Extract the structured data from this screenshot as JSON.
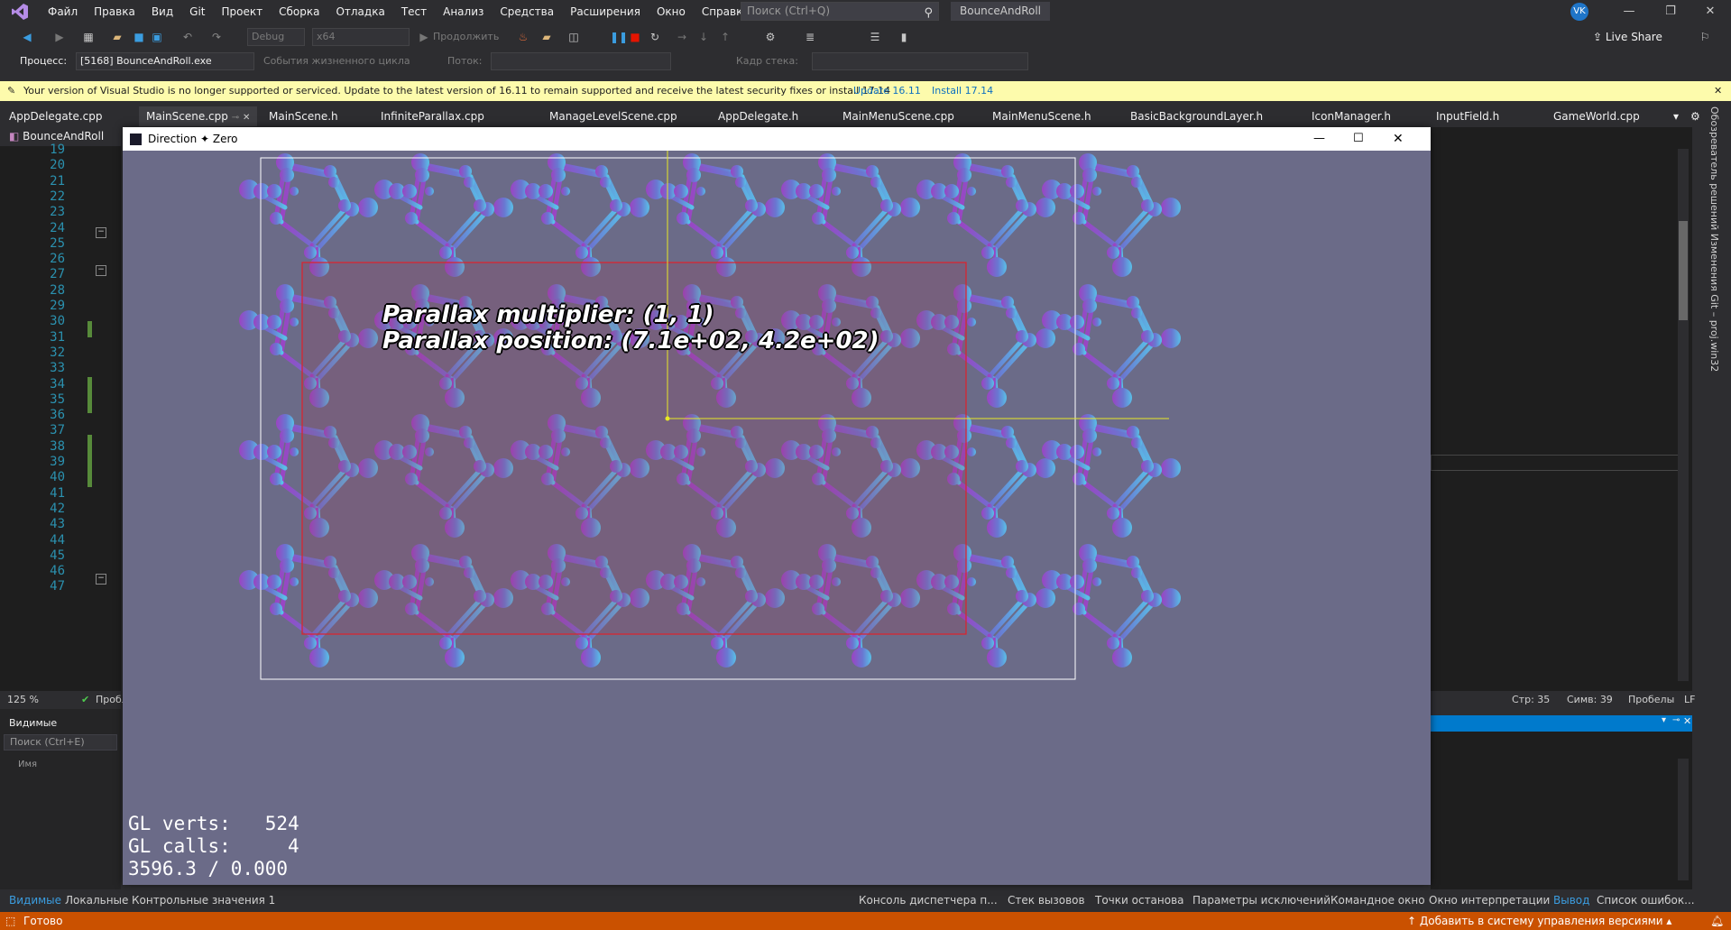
{
  "menu": {
    "items": [
      "Файл",
      "Правка",
      "Вид",
      "Git",
      "Проект",
      "Сборка",
      "Отладка",
      "Тест",
      "Анализ",
      "Средства",
      "Расширения",
      "Окно",
      "Справка"
    ],
    "search_placeholder": "Поиск (Ctrl+Q)",
    "solution_name": "BounceAndRoll",
    "user_initials": "VK"
  },
  "toolbar": {
    "config": "Debug",
    "platform": "x64",
    "continue_label": "Продолжить",
    "live_share": "Live Share",
    "process_label": "Процесс:",
    "process_value": "[5168] BounceAndRoll.exe",
    "lifecycle_label": "События жизненного цикла",
    "thread_label": "Поток:",
    "stack_frame_label": "Кадр стека:"
  },
  "infobar": {
    "message": "Your version of Visual Studio is no longer supported or serviced. Update to the latest version of 16.11 to remain supported and receive the latest security fixes or install 17.14",
    "link_update": "Update 16.11",
    "link_install": "Install 17.14"
  },
  "tabs": [
    "AppDelegate.cpp",
    "MainScene.cpp",
    "MainScene.h",
    "InfiniteParallax.cpp",
    "ManageLevelScene.cpp",
    "AppDelegate.h",
    "MainMenuScene.cpp",
    "MainMenuScene.h",
    "BasicBackgroundLayer.h",
    "IconManager.h",
    "InputField.h",
    "GameWorld.cpp"
  ],
  "editor": {
    "project_nav": "BounceAndRoll",
    "line_numbers": [
      "19",
      "20",
      "21",
      "22",
      "23",
      "24",
      "25",
      "26",
      "27",
      "28",
      "29",
      "30",
      "31",
      "32",
      "33",
      "34",
      "35",
      "36",
      "37",
      "38",
      "39",
      "40",
      "41",
      "42",
      "43",
      "44",
      "45",
      "46",
      "47"
    ],
    "zoom": "125 %",
    "problems": "Пробл",
    "status_line": "Стр: 35",
    "status_char": "Симв: 39",
    "status_spaces": "Пробелы",
    "status_eol": "LF"
  },
  "locals_panel": {
    "title": "Видимые",
    "search_placeholder": "Поиск (Ctrl+E)",
    "column_name": "Имя"
  },
  "game": {
    "window_title": "Direction ✦ Zero",
    "overlay_line1": "Parallax multiplier: (1, 1)",
    "overlay_line2": "Parallax position: (7.1e+02, 4.2e+02)",
    "stats_verts_label": "GL verts:",
    "stats_verts_value": "524",
    "stats_calls_label": "GL calls:",
    "stats_calls_value": "4",
    "stats_fps": "3596.3 / 0.000"
  },
  "bottom_tabs_left": [
    "Видимые",
    "Локальные",
    "Контрольные значения 1"
  ],
  "bottom_tabs_right": [
    "Консоль диспетчера п...",
    "Стек вызовов",
    "Точки останова",
    "Параметры исключений",
    "Командное окно",
    "Окно интерпретации",
    "Вывод",
    "Список ошибок..."
  ],
  "side_panel": "Обозреватель решений  Изменения Git – proj.win32",
  "statusbar": {
    "ready": "Готово",
    "source_control": "Добавить в систему управления версиями"
  },
  "colors": {
    "vs_bg": "#2d2d30",
    "accent": "#007acc",
    "status_debug": "#ca5100",
    "infobar": "#fdfbac",
    "game_bg": "#6b6b88",
    "border_red": "#e0202a",
    "guide_yellow": "#e8e826"
  }
}
